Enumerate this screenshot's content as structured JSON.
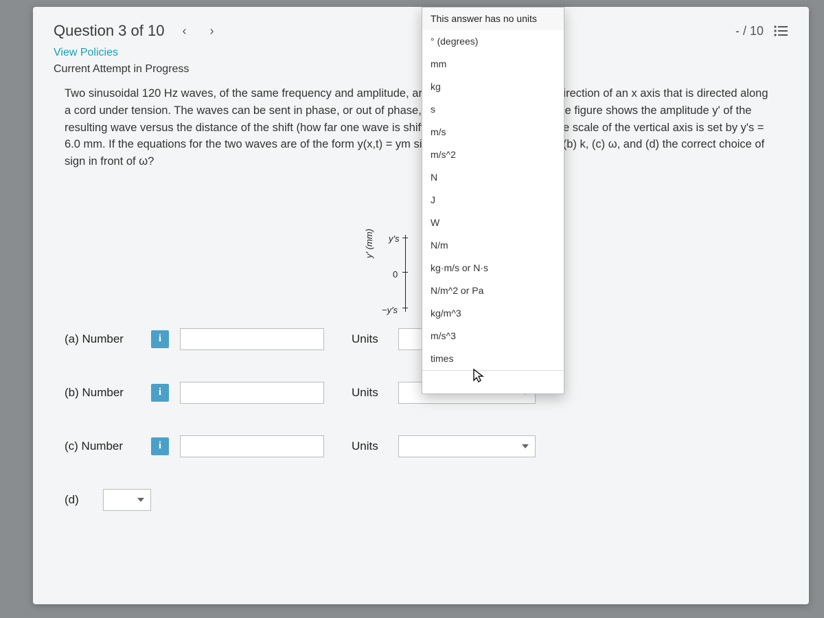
{
  "header": {
    "question_title": "Question 3 of 10",
    "score": "- / 10"
  },
  "links": {
    "view_policies": "View Policies",
    "attempt_status": "Current Attempt in Progress"
  },
  "problem": {
    "text": "Two sinusoidal 120 Hz waves, of the same frequency and amplitude, are to be sent in the positive direction of an x axis that is directed along a cord under tension. The waves can be sent in phase, or out of phase, by a shift of one of them. The figure shows the amplitude y' of the resulting wave versus the distance of the shift (how far one wave is shifted from the other wave). The scale of the vertical axis is set by y's = 6.0 mm. If the equations for the two waves are of the form y(x,t) = ym sin(kx ± ωt), what are (a) ym, (b) k, (c) ω, and (d) the correct choice of sign in front of ω?"
  },
  "chart": {
    "y_axis_label": "y' (mm)",
    "tick_top": "y's",
    "tick_mid": "0",
    "tick_bot": "−y's"
  },
  "answers": {
    "a": {
      "label": "(a)   Number",
      "units_label": "Units"
    },
    "b": {
      "label": "(b)   Number",
      "units_label": "Units"
    },
    "c": {
      "label": "(c)   Number",
      "units_label": "Units"
    },
    "d": {
      "label": "(d)"
    }
  },
  "units_dropdown": {
    "items": [
      "This answer has no units",
      "° (degrees)",
      "mm",
      "kg",
      "s",
      "m/s",
      "m/s^2",
      "N",
      "J",
      "W",
      "N/m",
      "kg·m/s or N·s",
      "N/m^2 or Pa",
      "kg/m^3",
      "m/s^3",
      "times"
    ]
  }
}
